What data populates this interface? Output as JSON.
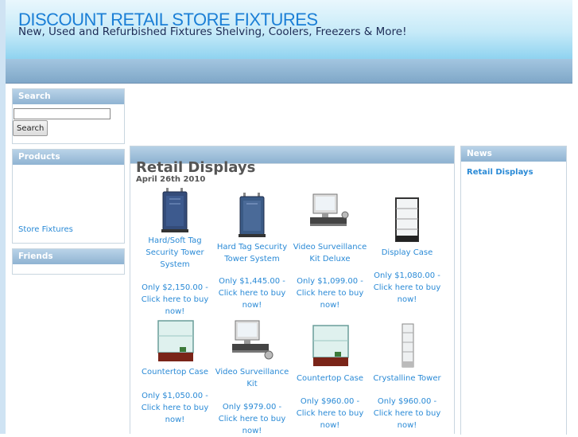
{
  "site": {
    "title": "DISCOUNT RETAIL STORE FIXTURES",
    "tagline": "New, Used and Refurbished Fixtures Shelving, Coolers, Freezers & More!"
  },
  "sidebar": {
    "search": {
      "title": "Search",
      "input_value": "",
      "button_label": "Search"
    },
    "products": {
      "title": "Products",
      "items": [
        "Store Fixtures"
      ]
    },
    "friends": {
      "title": "Friends"
    }
  },
  "main": {
    "title": "Retail Displays",
    "date": "April 26th 2010",
    "products": [
      {
        "name": "Hard/Soft Tag Security Tower System",
        "price": "Only $2,150.00 - Click here to buy now!",
        "icon": "security-tower-icon"
      },
      {
        "name": "Hard Tag Security Tower System",
        "price": "Only $1,445.00 - Click here to buy now!",
        "icon": "security-tower-icon"
      },
      {
        "name": "Video Surveillance Kit Deluxe",
        "price": "Only $1,099.00 - Click here to buy now!",
        "icon": "surveillance-kit-icon"
      },
      {
        "name": "Display Case",
        "price": "Only $1,080.00 - Click here to buy now!",
        "icon": "display-case-icon"
      },
      {
        "name": "Countertop Case",
        "price": "Only $1,050.00 - Click here to buy now!",
        "icon": "countertop-case-icon"
      },
      {
        "name": "Video Surveillance Kit",
        "price": "Only $979.00 - Click here to buy now!",
        "icon": "surveillance-kit-icon"
      },
      {
        "name": "Countertop Case",
        "price": "Only $960.00 - Click here to buy now!",
        "icon": "countertop-case-icon"
      },
      {
        "name": "Crystalline Tower",
        "price": "Only $960.00 - Click here to buy now!",
        "icon": "crystalline-tower-icon"
      }
    ]
  },
  "news": {
    "title": "News",
    "items": [
      "Retail Displays"
    ]
  },
  "colors": {
    "link": "#2a8ad6",
    "title": "#1b7fd6",
    "box_header": "#8fb3d2"
  }
}
